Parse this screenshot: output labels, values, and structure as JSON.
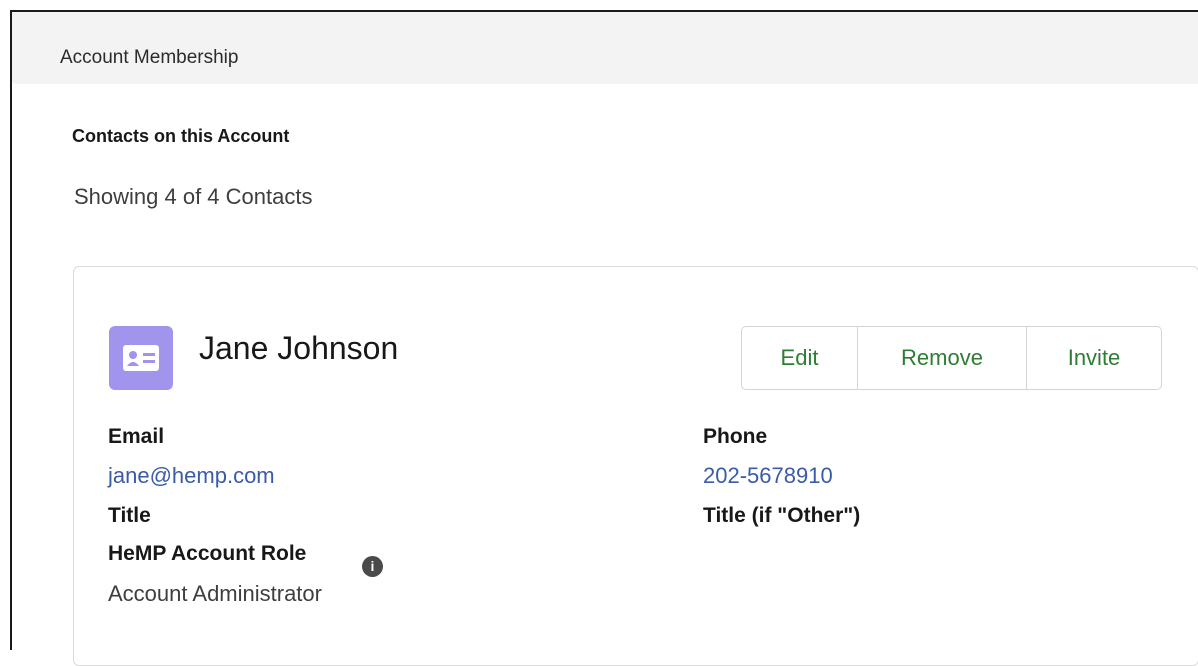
{
  "section": {
    "title": "Account Membership",
    "subheading": "Contacts on this Account",
    "showing": "Showing 4 of 4 Contacts"
  },
  "contact": {
    "name": "Jane Johnson",
    "icon": "contact-card-icon",
    "icon_color": "#a094ed",
    "actions": {
      "edit": "Edit",
      "remove": "Remove",
      "invite": "Invite"
    },
    "fields": {
      "email_label": "Email",
      "email_value": "jane@hemp.com",
      "phone_label": "Phone",
      "phone_value": "202-5678910",
      "title_label": "Title",
      "title_other_label": "Title (if \"Other\")",
      "role_label": "HeMP Account Role",
      "role_value": "Account Administrator"
    },
    "info_icon": "info-icon"
  },
  "colors": {
    "link": "#3a5ba9",
    "button_text": "#2e7d32",
    "header_bg": "#f3f3f3"
  }
}
